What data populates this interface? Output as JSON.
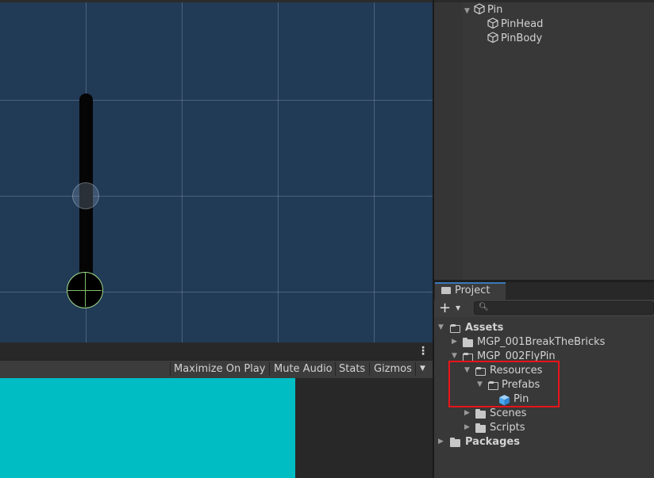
{
  "hierarchy": {
    "items": [
      {
        "label": "Pin",
        "expanded": true
      },
      {
        "label": "PinHead"
      },
      {
        "label": "PinBody"
      }
    ]
  },
  "game_view": {
    "toolbar": {
      "maximize_on_play": "Maximize On Play",
      "mute_audio": "Mute Audio",
      "stats": "Stats",
      "gizmos": "Gizmos"
    },
    "background_color": "#00bdc4"
  },
  "scene_view": {
    "background_color": "#213a56"
  },
  "project": {
    "tab_label": "Project",
    "add_label": "+",
    "search_placeholder": "",
    "tree": {
      "assets": "Assets",
      "break_the_bricks": "MGP_001BreakTheBricks",
      "fly_pin": "MGP_002FlyPin",
      "resources": "Resources",
      "prefabs": "Prefabs",
      "pin_prefab": "Pin",
      "scenes": "Scenes",
      "scripts": "Scripts",
      "packages": "Packages"
    },
    "highlight_color": "#e8141b"
  },
  "icons": [
    "cube-icon",
    "folder-icon",
    "prefab-icon",
    "search-icon",
    "kebab-menu-icon",
    "dropdown-arrow-icon"
  ]
}
